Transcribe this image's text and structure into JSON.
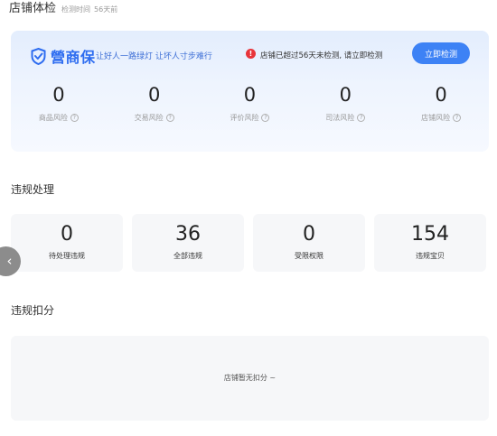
{
  "header": {
    "title": "店铺体检",
    "check_time_label": "检测时间",
    "check_time_value": "56天前"
  },
  "health_card": {
    "brand_name": "營商保",
    "slogan": "让好人一路绿灯 让坏人寸步难行",
    "alert_text": "店铺已超过56天未检测, 请立即检测",
    "detect_button": "立即检测",
    "risks": [
      {
        "value": "0",
        "label": "商品风险"
      },
      {
        "value": "0",
        "label": "交易风险"
      },
      {
        "value": "0",
        "label": "评价风险"
      },
      {
        "value": "0",
        "label": "司法风险"
      },
      {
        "value": "0",
        "label": "店铺风险"
      }
    ]
  },
  "violations": {
    "title": "违规处理",
    "stats": [
      {
        "value": "0",
        "label": "待处理违规"
      },
      {
        "value": "36",
        "label": "全部违规"
      },
      {
        "value": "0",
        "label": "受限权限"
      },
      {
        "value": "154",
        "label": "违规宝贝"
      }
    ]
  },
  "deductions": {
    "title": "违规扣分",
    "empty_text": "店铺暂无扣分 ~"
  },
  "colors": {
    "brand_blue": "#2d6cf0",
    "button_blue": "#3d82f5",
    "alert_red": "#e8343a",
    "card_gray": "#f6f7f9"
  },
  "icons": {
    "brand_logo": "shield-check-icon",
    "alert": "exclamation-circle-icon",
    "help": "question-circle-icon",
    "scroll_left": "chevron-left-icon"
  }
}
